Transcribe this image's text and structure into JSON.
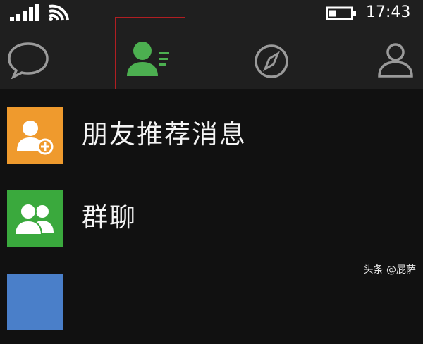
{
  "status_bar": {
    "time": "17:43"
  },
  "tabs": [
    {
      "id": "chats",
      "icon": "chat-bubble-icon",
      "active": false
    },
    {
      "id": "contacts",
      "icon": "contacts-icon",
      "active": true
    },
    {
      "id": "discover",
      "icon": "compass-icon",
      "active": false
    },
    {
      "id": "me",
      "icon": "person-icon",
      "active": false
    }
  ],
  "list": {
    "items": [
      {
        "label": "朋友推荐消息",
        "icon": "add-friend-icon",
        "tile_color": "#ef9a2d"
      },
      {
        "label": "群聊",
        "icon": "group-chat-icon",
        "tile_color": "#3aa93d"
      },
      {
        "label": "",
        "icon": "",
        "tile_color": "#4a7fc9"
      }
    ]
  },
  "watermark": "头条 @屁萨",
  "colors": {
    "accent_green": "#4caf50",
    "highlight_red": "#b01e22",
    "topbar": "#1f1f1f",
    "background": "#111111"
  }
}
